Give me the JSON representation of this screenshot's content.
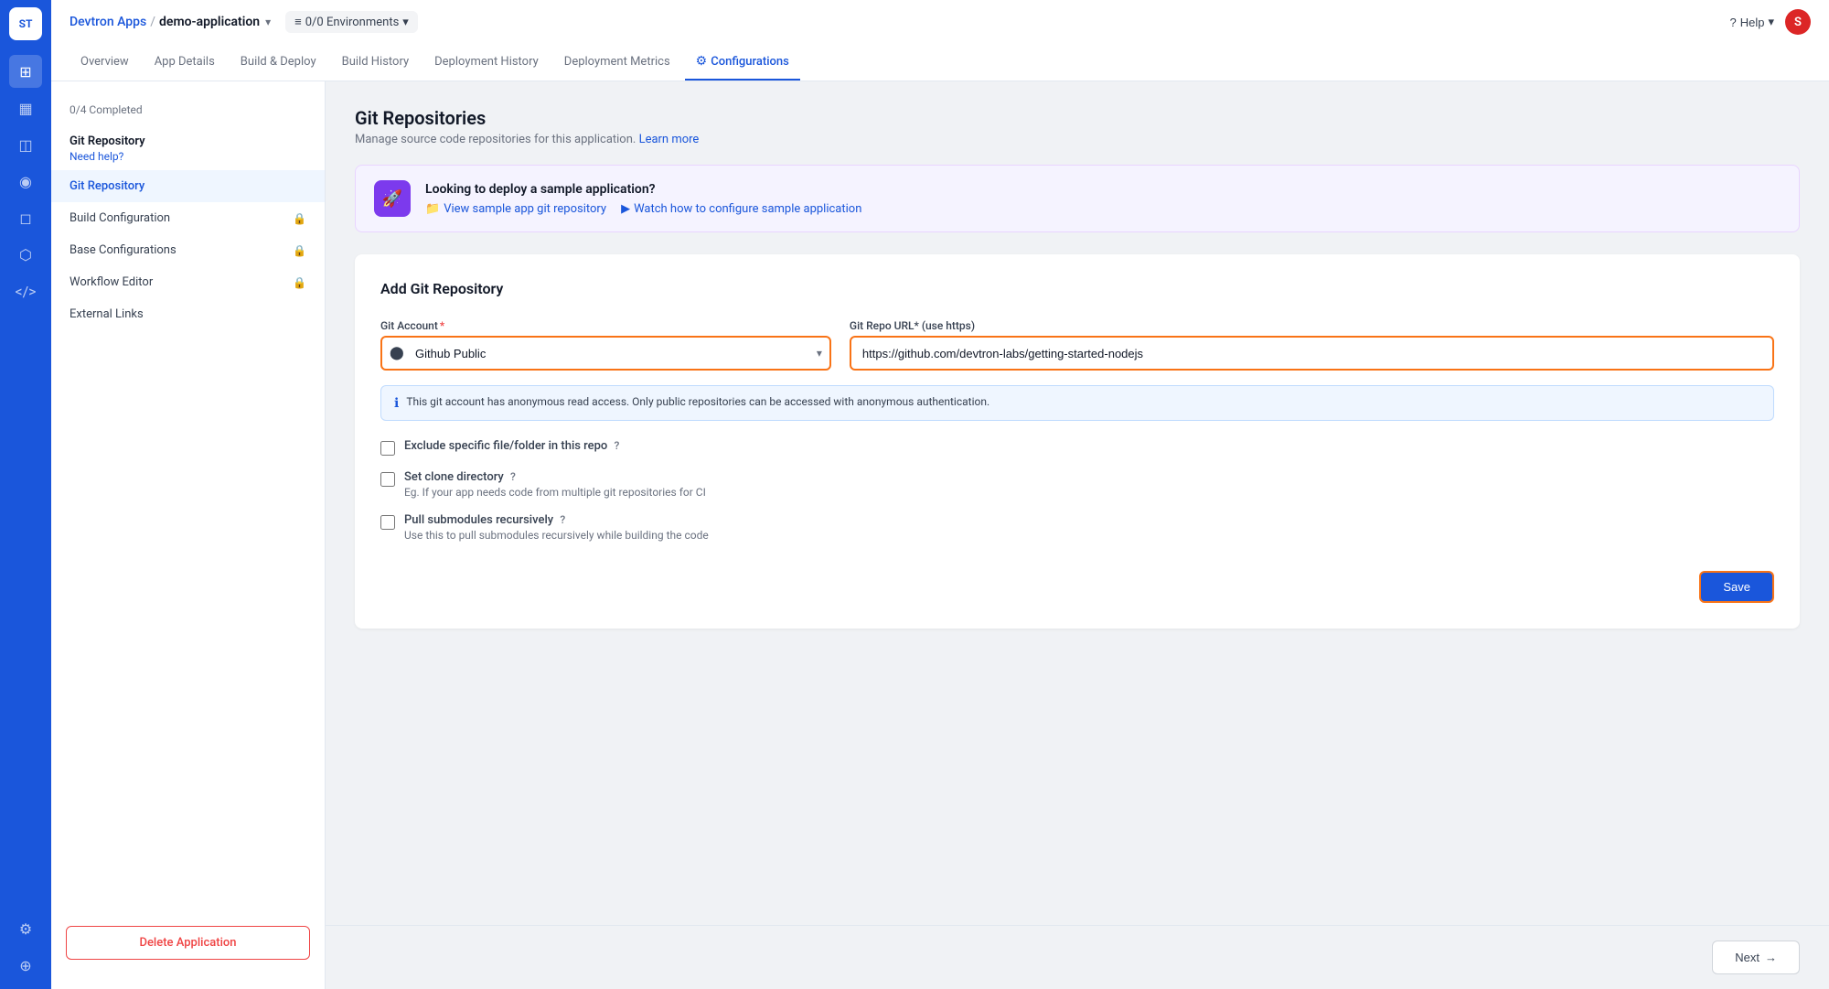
{
  "app": {
    "logo": "ST",
    "breadcrumb_app": "Devtron Apps",
    "breadcrumb_sep": "/",
    "breadcrumb_current": "demo-application",
    "env_label": "0/0 Environments",
    "help_label": "Help",
    "user_initial": "S"
  },
  "nav_tabs": [
    {
      "id": "overview",
      "label": "Overview",
      "active": false
    },
    {
      "id": "app-details",
      "label": "App Details",
      "active": false
    },
    {
      "id": "build-deploy",
      "label": "Build & Deploy",
      "active": false
    },
    {
      "id": "build-history",
      "label": "Build History",
      "active": false
    },
    {
      "id": "deployment-history",
      "label": "Deployment History",
      "active": false
    },
    {
      "id": "deployment-metrics",
      "label": "Deployment Metrics",
      "active": false
    },
    {
      "id": "configurations",
      "label": "Configurations",
      "active": true
    }
  ],
  "sidebar": {
    "progress": "0/4 Completed",
    "section_title": "Git Repository",
    "section_subtitle": "Need help?",
    "items": [
      {
        "id": "git-repository",
        "label": "Git Repository",
        "locked": false,
        "active": true
      },
      {
        "id": "build-configuration",
        "label": "Build Configuration",
        "locked": true,
        "active": false
      },
      {
        "id": "base-configurations",
        "label": "Base Configurations",
        "locked": true,
        "active": false
      },
      {
        "id": "workflow-editor",
        "label": "Workflow Editor",
        "locked": true,
        "active": false
      },
      {
        "id": "external-links",
        "label": "External Links",
        "locked": false,
        "active": false
      }
    ],
    "delete_label": "Delete Application"
  },
  "main": {
    "page_title": "Git Repositories",
    "page_subtitle": "Manage source code repositories for this application.",
    "learn_more": "Learn more",
    "banner": {
      "title": "Looking to deploy a sample application?",
      "link1_label": "View sample app git repository",
      "link2_label": "Watch how to configure sample application"
    },
    "form": {
      "title": "Add Git Repository",
      "git_account_label": "Git Account",
      "git_account_placeholder": "Github Public",
      "git_url_label": "Git Repo URL* (use https)",
      "git_url_value": "https://github.com/devtron-labs/getting-started-nodejs",
      "info_text": "This git account has anonymous read access. Only public repositories can be accessed with anonymous authentication.",
      "checkbox1_label": "Exclude specific file/folder in this repo",
      "checkbox2_label": "Set clone directory",
      "checkbox2_sub": "Eg. If your app needs code from multiple git repositories for CI",
      "checkbox3_label": "Pull submodules recursively",
      "checkbox3_sub": "Use this to pull submodules recursively while building the code",
      "save_label": "Save"
    }
  },
  "bottom_bar": {
    "next_label": "Next"
  },
  "icons": {
    "apps": "⊞",
    "deployments": "▦",
    "config": "⚙",
    "security": "🛡",
    "code": "</>",
    "settings": "⚙",
    "stack": "⊕",
    "info": "ℹ",
    "lock": "🔒",
    "folder": "📁",
    "play": "▶",
    "github": "⬤",
    "chevron_down": "▾",
    "chevron_right": "›",
    "arrow_right": "→"
  }
}
